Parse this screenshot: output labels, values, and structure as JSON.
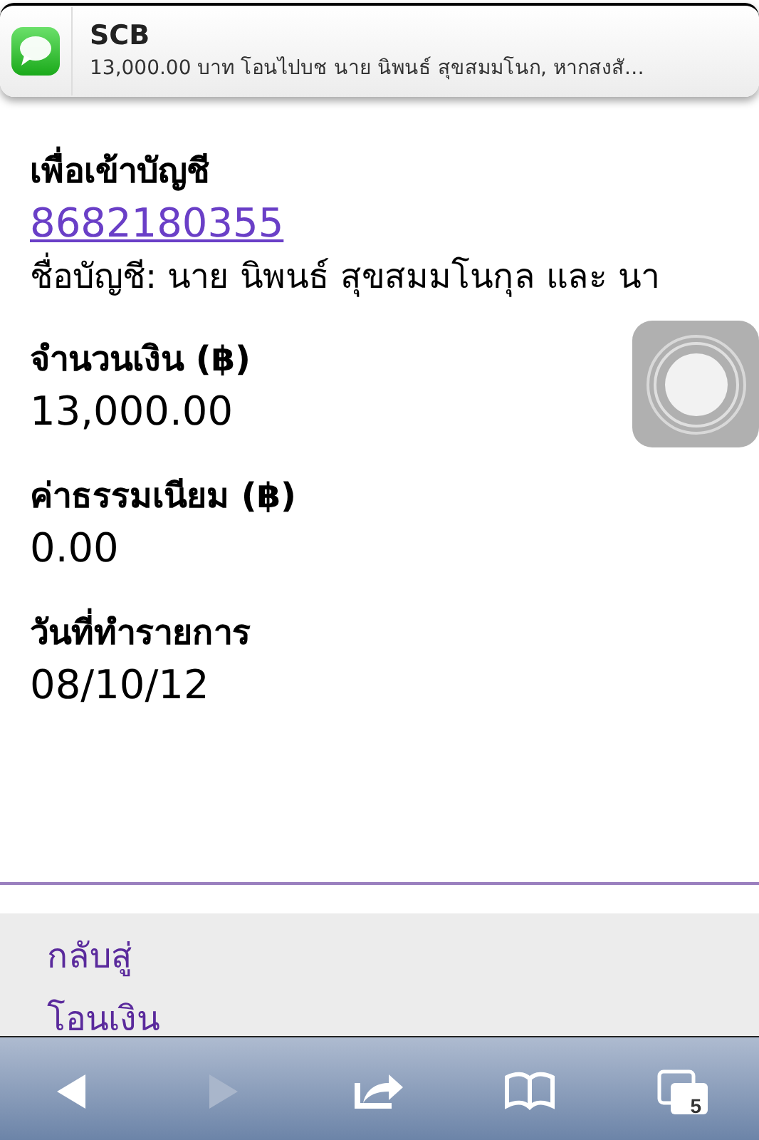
{
  "notification": {
    "title": "SCB",
    "message": "13,000.00 บาท โอนไปบช นาย นิพนธ์ สุขสมมโนก, หากสงสั…"
  },
  "fields": [
    {
      "kind": "link",
      "label": "เพื่อเข้าบัญชี",
      "value": "8682180355",
      "note": "ชื่อบัญชี: นาย นิพนธ์ สุขสมมโนกุล และ นา"
    },
    {
      "kind": "plain",
      "label": "จำนวนเงิน (฿)",
      "value": "13,000.00"
    },
    {
      "kind": "plain",
      "label": "ค่าธรรมเนียม (฿)",
      "value": "0.00"
    },
    {
      "kind": "plain",
      "label": "วันที่ทำรายการ",
      "value": "08/10/12"
    }
  ],
  "footer_links": [
    "กลับสู่",
    "โอนเงิน"
  ],
  "toolbar": [
    {
      "kind": "back",
      "disabled": false
    },
    {
      "kind": "forward",
      "disabled": true
    },
    {
      "kind": "share",
      "disabled": false
    },
    {
      "kind": "bookmarks",
      "disabled": false
    },
    {
      "kind": "tabs",
      "disabled": false,
      "count": "5"
    }
  ]
}
